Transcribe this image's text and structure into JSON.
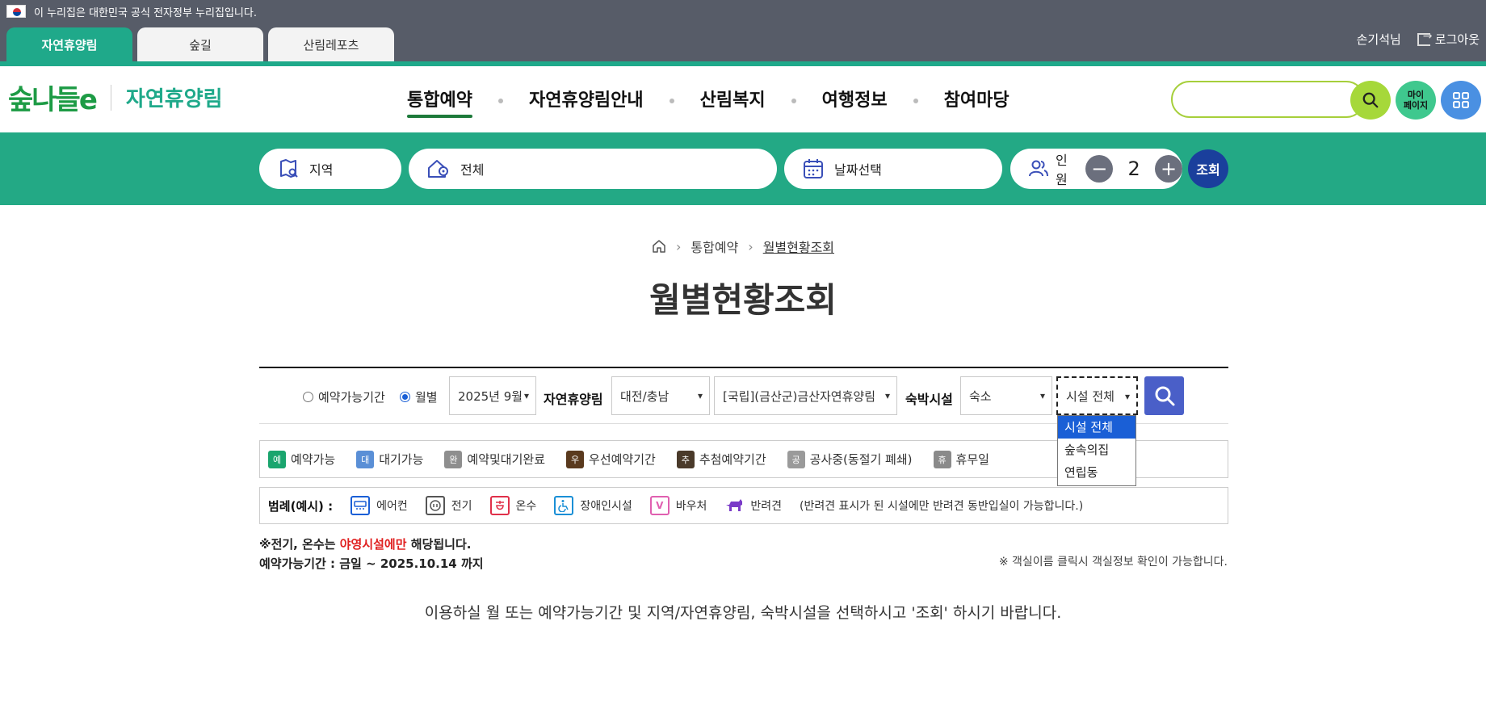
{
  "gov_banner": {
    "text": "이 누리집은 대한민국 공식 전자정부 누리집입니다."
  },
  "site_tabs": [
    {
      "label": "자연휴양림",
      "active": true
    },
    {
      "label": "숲길",
      "active": false
    },
    {
      "label": "산림레포츠",
      "active": false
    }
  ],
  "user": {
    "name": "손기석님",
    "logout_label": "로그아웃"
  },
  "logo": {
    "main": "숲나들e",
    "sub": "자연휴양림"
  },
  "gnb": [
    {
      "label": "통합예약",
      "active": true
    },
    {
      "label": "자연휴양림안내",
      "active": false
    },
    {
      "label": "산림복지",
      "active": false
    },
    {
      "label": "여행정보",
      "active": false
    },
    {
      "label": "참여마당",
      "active": false
    }
  ],
  "header_search": {
    "value": "",
    "placeholder": ""
  },
  "mypage_label": "마이\n페이지",
  "reservation_bar": {
    "region_label": "지역",
    "forest_label": "전체",
    "date_label": "날짜선택",
    "people_label": "인원",
    "people_count": "2",
    "query_label": "조회"
  },
  "breadcrumb": {
    "items": [
      "통합예약",
      "월별현황조회"
    ]
  },
  "page_title": "월별현황조회",
  "filters": {
    "radio_period_label": "예약가능기간",
    "radio_month_label": "월별",
    "radio_selected": "월별",
    "month_value": "2025년 9월",
    "forest_label": "자연휴양림",
    "region_value": "대전/충남",
    "forest_value": "[국립](금산군)금산자연휴양림",
    "lodging_label": "숙박시설",
    "lodging_type_value": "숙소",
    "facility_value": "시설 전체",
    "facility_options": [
      "시설 전체",
      "숲속의집",
      "연립동"
    ]
  },
  "status_legend": [
    {
      "badge": "예",
      "label": "예약가능",
      "color": "#1aa56e"
    },
    {
      "badge": "대",
      "label": "대기가능",
      "color": "#5a8fd6"
    },
    {
      "badge": "완",
      "label": "예약및대기완료",
      "color": "#8e8e8e"
    },
    {
      "badge": "우",
      "label": "우선예약기간",
      "color": "#5a3a1e"
    },
    {
      "badge": "추",
      "label": "추첨예약기간",
      "color": "#4a3a2a"
    },
    {
      "badge": "공",
      "label": "공사중(동절기 폐쇄)",
      "color": "#9a9a9a"
    },
    {
      "badge": "휴",
      "label": "휴무일",
      "color": "#8a8a8a"
    }
  ],
  "amenity_legend": {
    "title": "범례(예시) :",
    "items": [
      {
        "icon": "air-conditioner-icon",
        "label": "에어컨",
        "color": "#1a5fd6"
      },
      {
        "icon": "electric-plug-icon",
        "label": "전기",
        "color": "#555555"
      },
      {
        "icon": "hot-water-icon",
        "label": "온수",
        "color": "#e0304a"
      },
      {
        "icon": "wheelchair-icon",
        "label": "장애인시설",
        "color": "#1a8fd6"
      },
      {
        "icon": "voucher-icon",
        "label": "바우처",
        "color": "#e060b0"
      },
      {
        "icon": "dog-icon",
        "label": "반려견",
        "color": "#7a3ac8"
      }
    ],
    "pet_note": "(반려견 표시가 된 시설에만 반려견 동반입실이 가능합니다.)"
  },
  "notes": {
    "electric_prefix": "※전기, 온수는 ",
    "electric_highlight": "야영시설에만",
    "electric_suffix": " 해당됩니다.",
    "period": "예약가능기간 : 금일 ~ 2025.10.14 까지",
    "room_info": "※ 객실이름 클릭시 객실정보 확인이 가능합니다."
  },
  "guide_text": "이용하실 월 또는 예약가능기간 및 지역/자연휴양림, 숙박시설을 선택하시고 '조회' 하시기 바랍니다."
}
